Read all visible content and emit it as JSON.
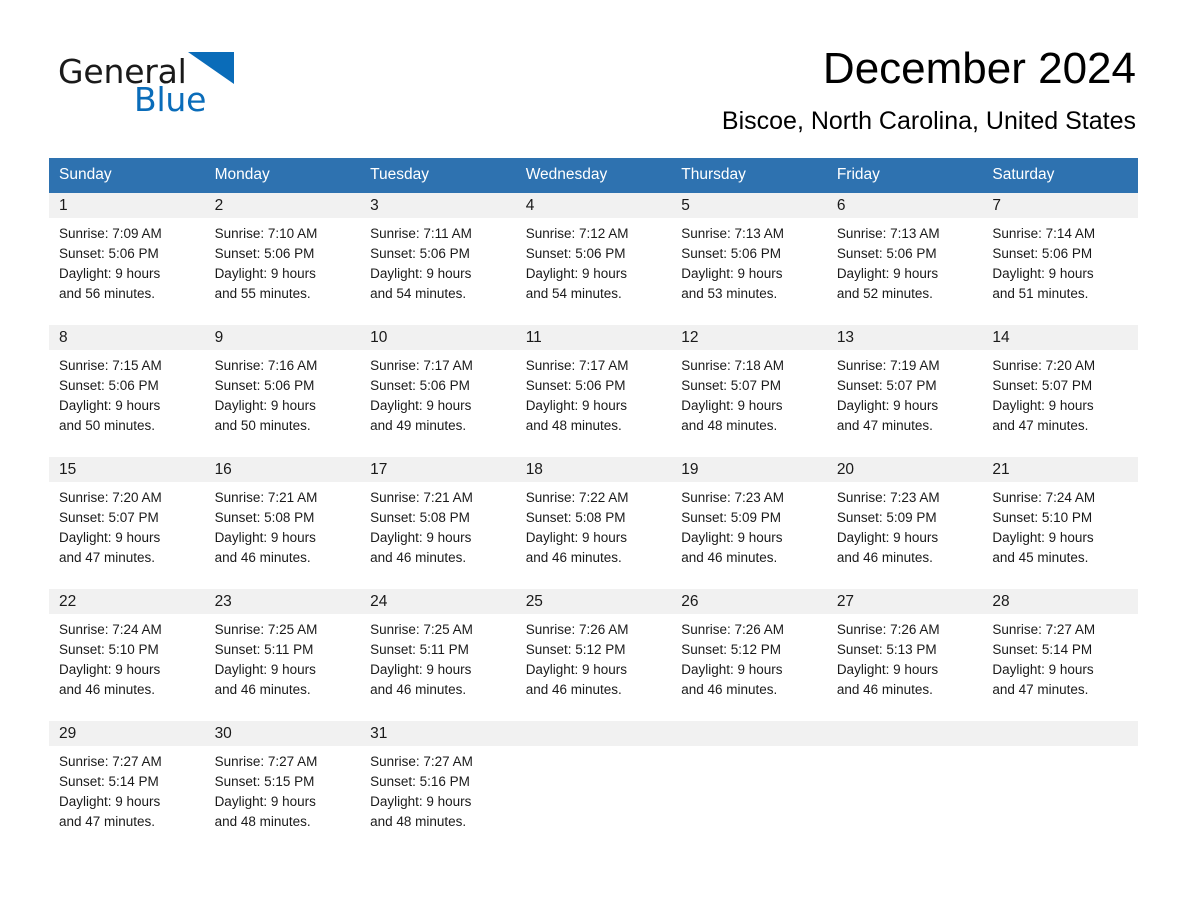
{
  "brand": {
    "name_part1": "General",
    "name_part2": "Blue",
    "accent_color": "#0a6cb9",
    "triangle_icon": "triangle-icon"
  },
  "header": {
    "month_title": "December 2024",
    "location": "Biscoe, North Carolina, United States"
  },
  "theme": {
    "header_blue": "#2e72b0",
    "daynum_gray": "#f1f1f1",
    "text": "#1a1a1a"
  },
  "calendar": {
    "weekday_headers": [
      "Sunday",
      "Monday",
      "Tuesday",
      "Wednesday",
      "Thursday",
      "Friday",
      "Saturday"
    ],
    "weeks": [
      [
        {
          "day": "1",
          "sunrise": "Sunrise: 7:09 AM",
          "sunset": "Sunset: 5:06 PM",
          "daylight_line1": "Daylight: 9 hours",
          "daylight_line2": "and 56 minutes."
        },
        {
          "day": "2",
          "sunrise": "Sunrise: 7:10 AM",
          "sunset": "Sunset: 5:06 PM",
          "daylight_line1": "Daylight: 9 hours",
          "daylight_line2": "and 55 minutes."
        },
        {
          "day": "3",
          "sunrise": "Sunrise: 7:11 AM",
          "sunset": "Sunset: 5:06 PM",
          "daylight_line1": "Daylight: 9 hours",
          "daylight_line2": "and 54 minutes."
        },
        {
          "day": "4",
          "sunrise": "Sunrise: 7:12 AM",
          "sunset": "Sunset: 5:06 PM",
          "daylight_line1": "Daylight: 9 hours",
          "daylight_line2": "and 54 minutes."
        },
        {
          "day": "5",
          "sunrise": "Sunrise: 7:13 AM",
          "sunset": "Sunset: 5:06 PM",
          "daylight_line1": "Daylight: 9 hours",
          "daylight_line2": "and 53 minutes."
        },
        {
          "day": "6",
          "sunrise": "Sunrise: 7:13 AM",
          "sunset": "Sunset: 5:06 PM",
          "daylight_line1": "Daylight: 9 hours",
          "daylight_line2": "and 52 minutes."
        },
        {
          "day": "7",
          "sunrise": "Sunrise: 7:14 AM",
          "sunset": "Sunset: 5:06 PM",
          "daylight_line1": "Daylight: 9 hours",
          "daylight_line2": "and 51 minutes."
        }
      ],
      [
        {
          "day": "8",
          "sunrise": "Sunrise: 7:15 AM",
          "sunset": "Sunset: 5:06 PM",
          "daylight_line1": "Daylight: 9 hours",
          "daylight_line2": "and 50 minutes."
        },
        {
          "day": "9",
          "sunrise": "Sunrise: 7:16 AM",
          "sunset": "Sunset: 5:06 PM",
          "daylight_line1": "Daylight: 9 hours",
          "daylight_line2": "and 50 minutes."
        },
        {
          "day": "10",
          "sunrise": "Sunrise: 7:17 AM",
          "sunset": "Sunset: 5:06 PM",
          "daylight_line1": "Daylight: 9 hours",
          "daylight_line2": "and 49 minutes."
        },
        {
          "day": "11",
          "sunrise": "Sunrise: 7:17 AM",
          "sunset": "Sunset: 5:06 PM",
          "daylight_line1": "Daylight: 9 hours",
          "daylight_line2": "and 48 minutes."
        },
        {
          "day": "12",
          "sunrise": "Sunrise: 7:18 AM",
          "sunset": "Sunset: 5:07 PM",
          "daylight_line1": "Daylight: 9 hours",
          "daylight_line2": "and 48 minutes."
        },
        {
          "day": "13",
          "sunrise": "Sunrise: 7:19 AM",
          "sunset": "Sunset: 5:07 PM",
          "daylight_line1": "Daylight: 9 hours",
          "daylight_line2": "and 47 minutes."
        },
        {
          "day": "14",
          "sunrise": "Sunrise: 7:20 AM",
          "sunset": "Sunset: 5:07 PM",
          "daylight_line1": "Daylight: 9 hours",
          "daylight_line2": "and 47 minutes."
        }
      ],
      [
        {
          "day": "15",
          "sunrise": "Sunrise: 7:20 AM",
          "sunset": "Sunset: 5:07 PM",
          "daylight_line1": "Daylight: 9 hours",
          "daylight_line2": "and 47 minutes."
        },
        {
          "day": "16",
          "sunrise": "Sunrise: 7:21 AM",
          "sunset": "Sunset: 5:08 PM",
          "daylight_line1": "Daylight: 9 hours",
          "daylight_line2": "and 46 minutes."
        },
        {
          "day": "17",
          "sunrise": "Sunrise: 7:21 AM",
          "sunset": "Sunset: 5:08 PM",
          "daylight_line1": "Daylight: 9 hours",
          "daylight_line2": "and 46 minutes."
        },
        {
          "day": "18",
          "sunrise": "Sunrise: 7:22 AM",
          "sunset": "Sunset: 5:08 PM",
          "daylight_line1": "Daylight: 9 hours",
          "daylight_line2": "and 46 minutes."
        },
        {
          "day": "19",
          "sunrise": "Sunrise: 7:23 AM",
          "sunset": "Sunset: 5:09 PM",
          "daylight_line1": "Daylight: 9 hours",
          "daylight_line2": "and 46 minutes."
        },
        {
          "day": "20",
          "sunrise": "Sunrise: 7:23 AM",
          "sunset": "Sunset: 5:09 PM",
          "daylight_line1": "Daylight: 9 hours",
          "daylight_line2": "and 46 minutes."
        },
        {
          "day": "21",
          "sunrise": "Sunrise: 7:24 AM",
          "sunset": "Sunset: 5:10 PM",
          "daylight_line1": "Daylight: 9 hours",
          "daylight_line2": "and 45 minutes."
        }
      ],
      [
        {
          "day": "22",
          "sunrise": "Sunrise: 7:24 AM",
          "sunset": "Sunset: 5:10 PM",
          "daylight_line1": "Daylight: 9 hours",
          "daylight_line2": "and 46 minutes."
        },
        {
          "day": "23",
          "sunrise": "Sunrise: 7:25 AM",
          "sunset": "Sunset: 5:11 PM",
          "daylight_line1": "Daylight: 9 hours",
          "daylight_line2": "and 46 minutes."
        },
        {
          "day": "24",
          "sunrise": "Sunrise: 7:25 AM",
          "sunset": "Sunset: 5:11 PM",
          "daylight_line1": "Daylight: 9 hours",
          "daylight_line2": "and 46 minutes."
        },
        {
          "day": "25",
          "sunrise": "Sunrise: 7:26 AM",
          "sunset": "Sunset: 5:12 PM",
          "daylight_line1": "Daylight: 9 hours",
          "daylight_line2": "and 46 minutes."
        },
        {
          "day": "26",
          "sunrise": "Sunrise: 7:26 AM",
          "sunset": "Sunset: 5:12 PM",
          "daylight_line1": "Daylight: 9 hours",
          "daylight_line2": "and 46 minutes."
        },
        {
          "day": "27",
          "sunrise": "Sunrise: 7:26 AM",
          "sunset": "Sunset: 5:13 PM",
          "daylight_line1": "Daylight: 9 hours",
          "daylight_line2": "and 46 minutes."
        },
        {
          "day": "28",
          "sunrise": "Sunrise: 7:27 AM",
          "sunset": "Sunset: 5:14 PM",
          "daylight_line1": "Daylight: 9 hours",
          "daylight_line2": "and 47 minutes."
        }
      ],
      [
        {
          "day": "29",
          "sunrise": "Sunrise: 7:27 AM",
          "sunset": "Sunset: 5:14 PM",
          "daylight_line1": "Daylight: 9 hours",
          "daylight_line2": "and 47 minutes."
        },
        {
          "day": "30",
          "sunrise": "Sunrise: 7:27 AM",
          "sunset": "Sunset: 5:15 PM",
          "daylight_line1": "Daylight: 9 hours",
          "daylight_line2": "and 48 minutes."
        },
        {
          "day": "31",
          "sunrise": "Sunrise: 7:27 AM",
          "sunset": "Sunset: 5:16 PM",
          "daylight_line1": "Daylight: 9 hours",
          "daylight_line2": "and 48 minutes."
        },
        {
          "day": "",
          "sunrise": "",
          "sunset": "",
          "daylight_line1": "",
          "daylight_line2": ""
        },
        {
          "day": "",
          "sunrise": "",
          "sunset": "",
          "daylight_line1": "",
          "daylight_line2": ""
        },
        {
          "day": "",
          "sunrise": "",
          "sunset": "",
          "daylight_line1": "",
          "daylight_line2": ""
        },
        {
          "day": "",
          "sunrise": "",
          "sunset": "",
          "daylight_line1": "",
          "daylight_line2": ""
        }
      ]
    ]
  }
}
